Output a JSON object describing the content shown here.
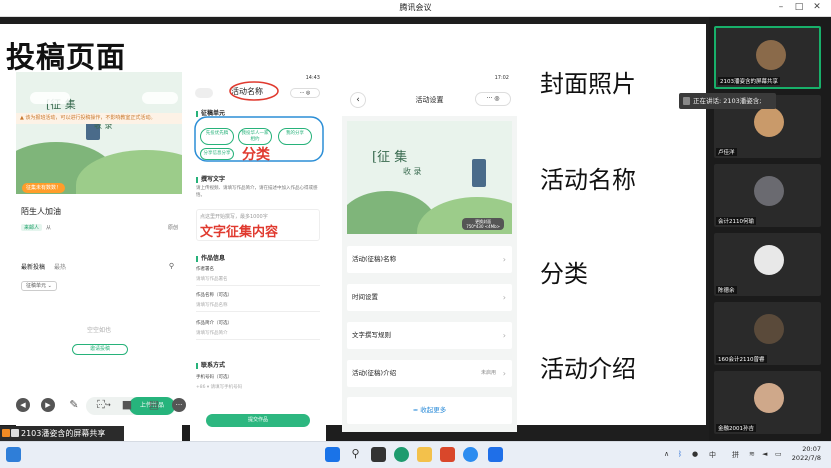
{
  "window": {
    "title": "腾讯会议"
  },
  "slide": {
    "title": "投稿页面",
    "right_labels": [
      "封面照片",
      "活动名称",
      "分类",
      "活动介绍"
    ]
  },
  "phone1": {
    "notice": "▲ 该为报班活动，可以进行投稿操作，不影响教室正式活动。",
    "banner_text_1": "[征 集",
    "banner_text_2": "收 录",
    "badge": "征集未有数数！",
    "name": "陌生人加油",
    "sub_tag": "来邮人",
    "sub_text": "从",
    "right_text": "原创",
    "tab_latest": "最新投稿",
    "tab_recent": "最热",
    "dropdown": "征稿单元 ⌄",
    "empty": "空空如也",
    "button": "邀请投稿",
    "upload": "上传作品"
  },
  "phone2": {
    "status_time": "14:43",
    "title": "活动名称",
    "section1": "征稿单元",
    "chips": [
      "先投优先稿",
      "我投华人一家\n相约",
      "我的分享",
      "分享信息分享"
    ],
    "annot_category": "分类",
    "section2": "撰写文字",
    "desc": "请上传视频、请填写作品简介，请在描述中加入作品心得或感悟。",
    "placeholder": "点这里开始撰写，最多1000字",
    "annot_text": "文字征集内容",
    "section3": "作品信息",
    "f1_label": "作者署名",
    "f1_val": "请填写作品署名",
    "f2_label": "作品名称（可选）",
    "f2_val": "请填写作品名称",
    "f3_label": "作品简介（可选）",
    "f3_val": "请填写作品简介",
    "section4": "联系方式",
    "f4_label": "手机号码（可选）",
    "f4_val": "+86 ▾  请填写手机号码",
    "submit": "提交作品"
  },
  "phone3": {
    "status_time": "17:02",
    "title": "活动设置",
    "cover_text_1": "[征 集",
    "cover_text_2": "收 录",
    "change_cover": "更换封面\n750*430 <4Mb>",
    "rows": [
      {
        "label": "活动(征稿)名称",
        "value": ""
      },
      {
        "label": "时间设置",
        "value": ""
      },
      {
        "label": "文字撰写规则",
        "value": ""
      },
      {
        "label": "活动(征稿)介绍",
        "value": "未启用"
      }
    ],
    "more": "收起更多"
  },
  "share": {
    "text": "2103潘姿含的屏幕共享"
  },
  "tooltip": {
    "text": "正在讲话: 2103潘姿含;"
  },
  "participants": [
    {
      "name": "2103潘姿含的屏幕共享",
      "avatar_color": "#8a6a4a"
    },
    {
      "name": "卢佳洋",
      "avatar_color": "#c99a6a"
    },
    {
      "name": "会计2110何瑜",
      "avatar_color": "#6a6a70"
    },
    {
      "name": "陈德余",
      "avatar_color": "#e8e8e8"
    },
    {
      "name": "160会计2110曾睿",
      "avatar_color": "#5a4a3a"
    },
    {
      "name": "金融2001孙吉",
      "avatar_color": "#cfa88a"
    }
  ],
  "taskbar": {
    "tray_text": "中",
    "ime": "拼",
    "time": "20:07",
    "date": "2022/7/8"
  }
}
